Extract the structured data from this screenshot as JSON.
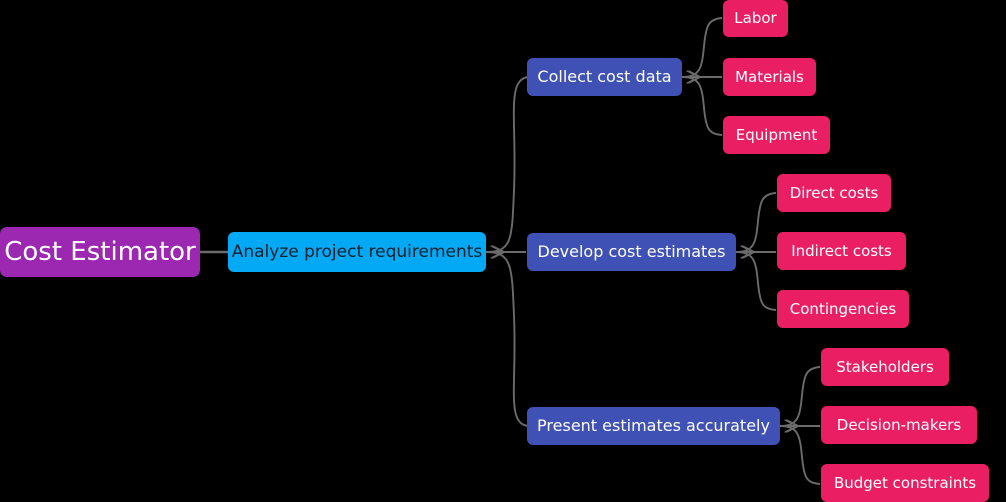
{
  "diagram": {
    "type": "mindmap",
    "orientation": "left-to-right",
    "background_color": "#000000",
    "edge_color": "#6b6b6b",
    "colors": {
      "root": "#9C27B0",
      "level1": "#03A9F4",
      "level2": "#3F51B5",
      "level3": "#E91E63",
      "root_text": "#FFFFFF",
      "level1_text": "#14202B",
      "level2_text": "#FFFFFF",
      "level3_text": "#FFFFFF"
    },
    "root": {
      "label": "Cost Estimator"
    },
    "level1": {
      "label": "Analyze project requirements"
    },
    "branches": [
      {
        "label": "Collect cost data",
        "children": [
          {
            "label": "Labor"
          },
          {
            "label": "Materials"
          },
          {
            "label": "Equipment"
          }
        ]
      },
      {
        "label": "Develop cost estimates",
        "children": [
          {
            "label": "Direct costs"
          },
          {
            "label": "Indirect costs"
          },
          {
            "label": "Contingencies"
          }
        ]
      },
      {
        "label": "Present estimates accurately",
        "children": [
          {
            "label": "Stakeholders"
          },
          {
            "label": "Decision-makers"
          },
          {
            "label": "Budget constraints"
          }
        ]
      }
    ]
  }
}
